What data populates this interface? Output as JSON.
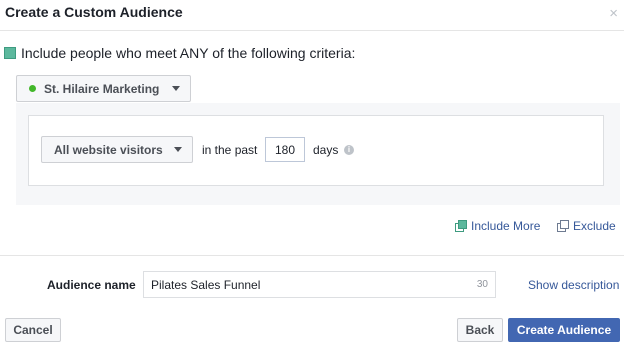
{
  "dialog": {
    "title": "Create a Custom Audience",
    "close_label": "×"
  },
  "criteria": {
    "text": "Include people who meet ANY of the following criteria:"
  },
  "pixel": {
    "name": "St. Hilaire Marketing",
    "status_color": "#42b72a"
  },
  "rule": {
    "visitor_type": "All website visitors",
    "in_the_past_label": "in the past",
    "days_value": "180",
    "days_label": "days"
  },
  "actions": {
    "include_more": "Include More",
    "exclude": "Exclude"
  },
  "audience": {
    "label": "Audience name",
    "name_value": "Pilates Sales Funnel",
    "char_count": "30",
    "show_description": "Show description"
  },
  "footer": {
    "cancel": "Cancel",
    "back": "Back",
    "create": "Create Audience"
  },
  "colors": {
    "primary": "#4267b2",
    "link": "#365899",
    "accent_green": "#5cb89d"
  }
}
